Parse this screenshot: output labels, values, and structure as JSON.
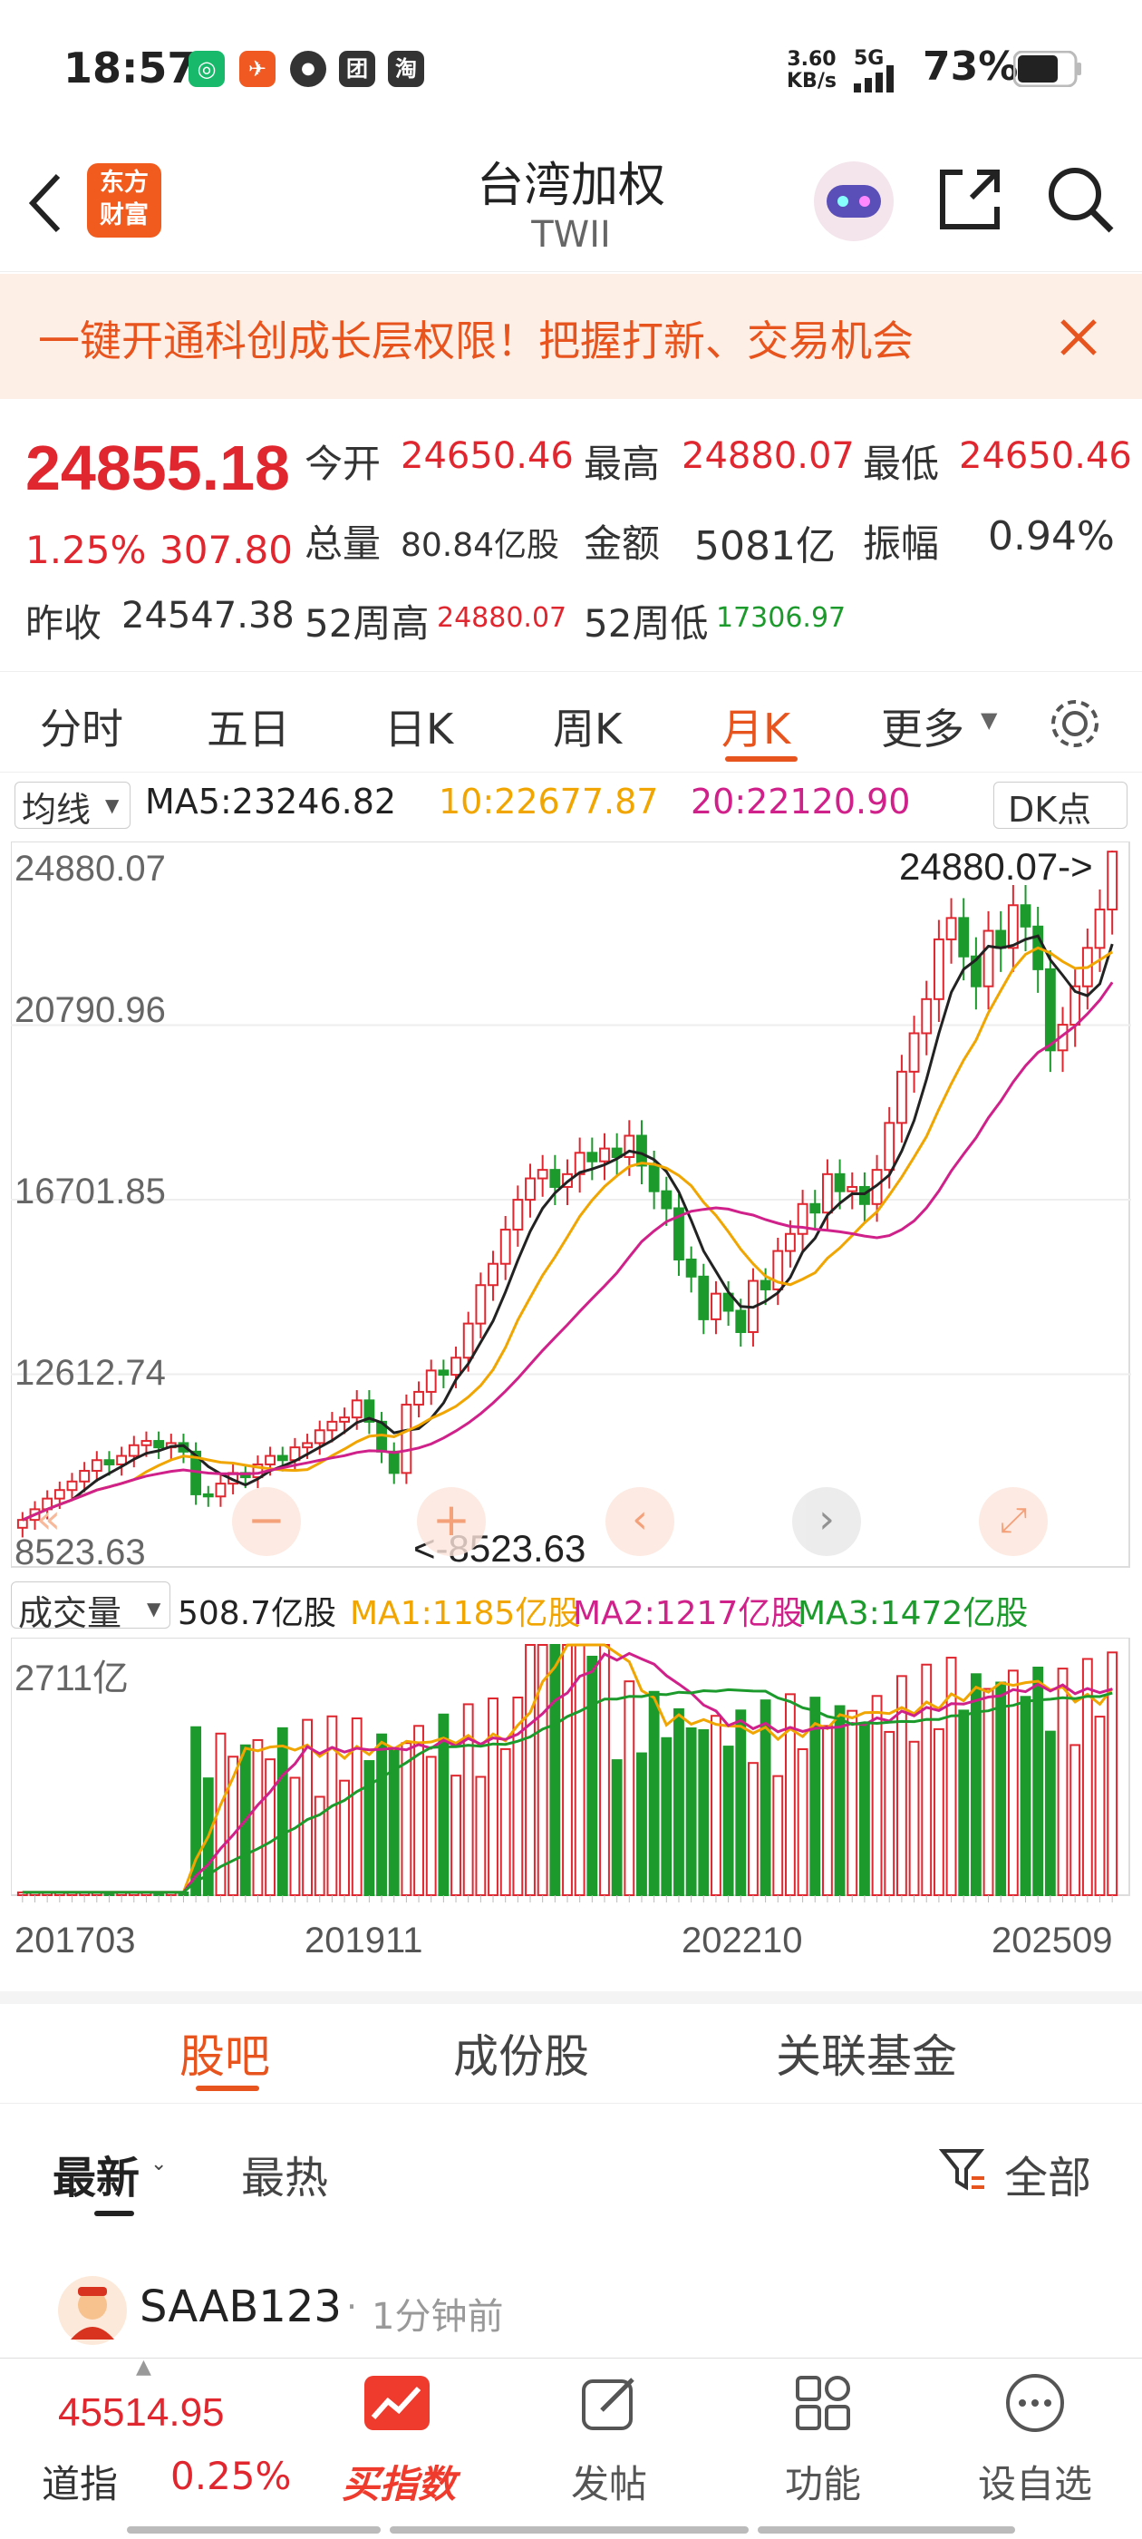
{
  "status_bar": {
    "time": "18:57",
    "net_speed_top": "3.60",
    "net_speed_bottom": "KB/s",
    "signal": "5G",
    "battery": "73%"
  },
  "header": {
    "logo_top": "东方",
    "logo_bottom": "财富",
    "title": "台湾加权",
    "subtitle": "TWII"
  },
  "banner": {
    "text": "一键开通科创成长层权限！把握打新、交易机会"
  },
  "quote": {
    "price": "24855.18",
    "change_pct": "1.25%",
    "change": "307.80",
    "open_label": "今开",
    "open": "24650.46",
    "high_label": "最高",
    "high": "24880.07",
    "low_label": "最低",
    "low": "24650.46",
    "volume_label": "总量",
    "volume": "80.84亿股",
    "amount_label": "金额",
    "amount": "5081亿",
    "amplitude_label": "振幅",
    "amplitude": "0.94%",
    "prev_close_label": "昨收",
    "prev_close": "24547.38",
    "wk52_high_label": "52周高",
    "wk52_high": "24880.07",
    "wk52_low_label": "52周低",
    "wk52_low": "17306.97"
  },
  "tabs": [
    "分时",
    "五日",
    "日K",
    "周K",
    "月K",
    "更多"
  ],
  "active_tab": "月K",
  "chart": {
    "ma_selector": "均线",
    "ma5": "MA5:23246.82",
    "ma10": "10:22677.87",
    "ma20": "20:22120.90",
    "dk_button": "DK点",
    "y_labels": [
      "24880.07",
      "20790.96",
      "16701.85",
      "12612.74",
      "8523.63"
    ],
    "max_marker": "24880.07->",
    "min_marker": "<-8523.63",
    "vol_selector": "成交量",
    "vol_value": "508.7亿股",
    "vol_ma1": "MA1:1185亿股",
    "vol_ma2": "MA2:1217亿股",
    "vol_ma3": "MA3:1472亿股",
    "vol_max": "2711亿",
    "x_labels": [
      "201703",
      "201911",
      "202210",
      "202509"
    ],
    "colors": {
      "up": "#e0262f",
      "down": "#1c9a2c",
      "ma5": "#222222",
      "ma10": "#f0a500",
      "ma20": "#d0208a"
    }
  },
  "chart_data": {
    "type": "candlestick",
    "ylim": [
      8523.63,
      24880.07
    ],
    "closes": [
      9200,
      9450,
      9700,
      9900,
      10100,
      10350,
      10600,
      10500,
      10700,
      10950,
      11050,
      10900,
      11000,
      10800,
      9800,
      9750,
      10050,
      10300,
      10200,
      10500,
      10700,
      10600,
      10900,
      11000,
      11300,
      11500,
      11600,
      12000,
      11500,
      10800,
      10300,
      11900,
      12200,
      12700,
      12600,
      13000,
      13800,
      14700,
      15200,
      16000,
      16700,
      17200,
      17400,
      17000,
      17300,
      17800,
      17600,
      17900,
      17700,
      18200,
      17500,
      16900,
      16500,
      15300,
      14900,
      13900,
      14500,
      14100,
      13600,
      14800,
      14600,
      15500,
      15900,
      16600,
      16400,
      17300,
      16900,
      17000,
      16600,
      17400,
      18500,
      19700,
      20600,
      21400,
      22800,
      23300,
      22400,
      21700,
      23000,
      22600,
      23600,
      23100,
      22100,
      20200,
      20800,
      21700,
      22600,
      23500,
      24855.18
    ],
    "volume_unit": "亿股",
    "volume_max": 2711
  },
  "sub_tabs": [
    "股吧",
    "成份股",
    "关联基金"
  ],
  "active_sub_tab": "股吧",
  "feed": {
    "sort_latest": "最新",
    "sort_hot": "最热",
    "filter_label": "全部",
    "post_user": "SAAB123",
    "post_time": "1分钟前"
  },
  "footer": {
    "index_value": "45514.95",
    "index_name": "道指",
    "index_change": "0.25%",
    "buy_label": "买指数",
    "post_label": "发帖",
    "func_label": "功能",
    "watch_label": "设自选"
  }
}
